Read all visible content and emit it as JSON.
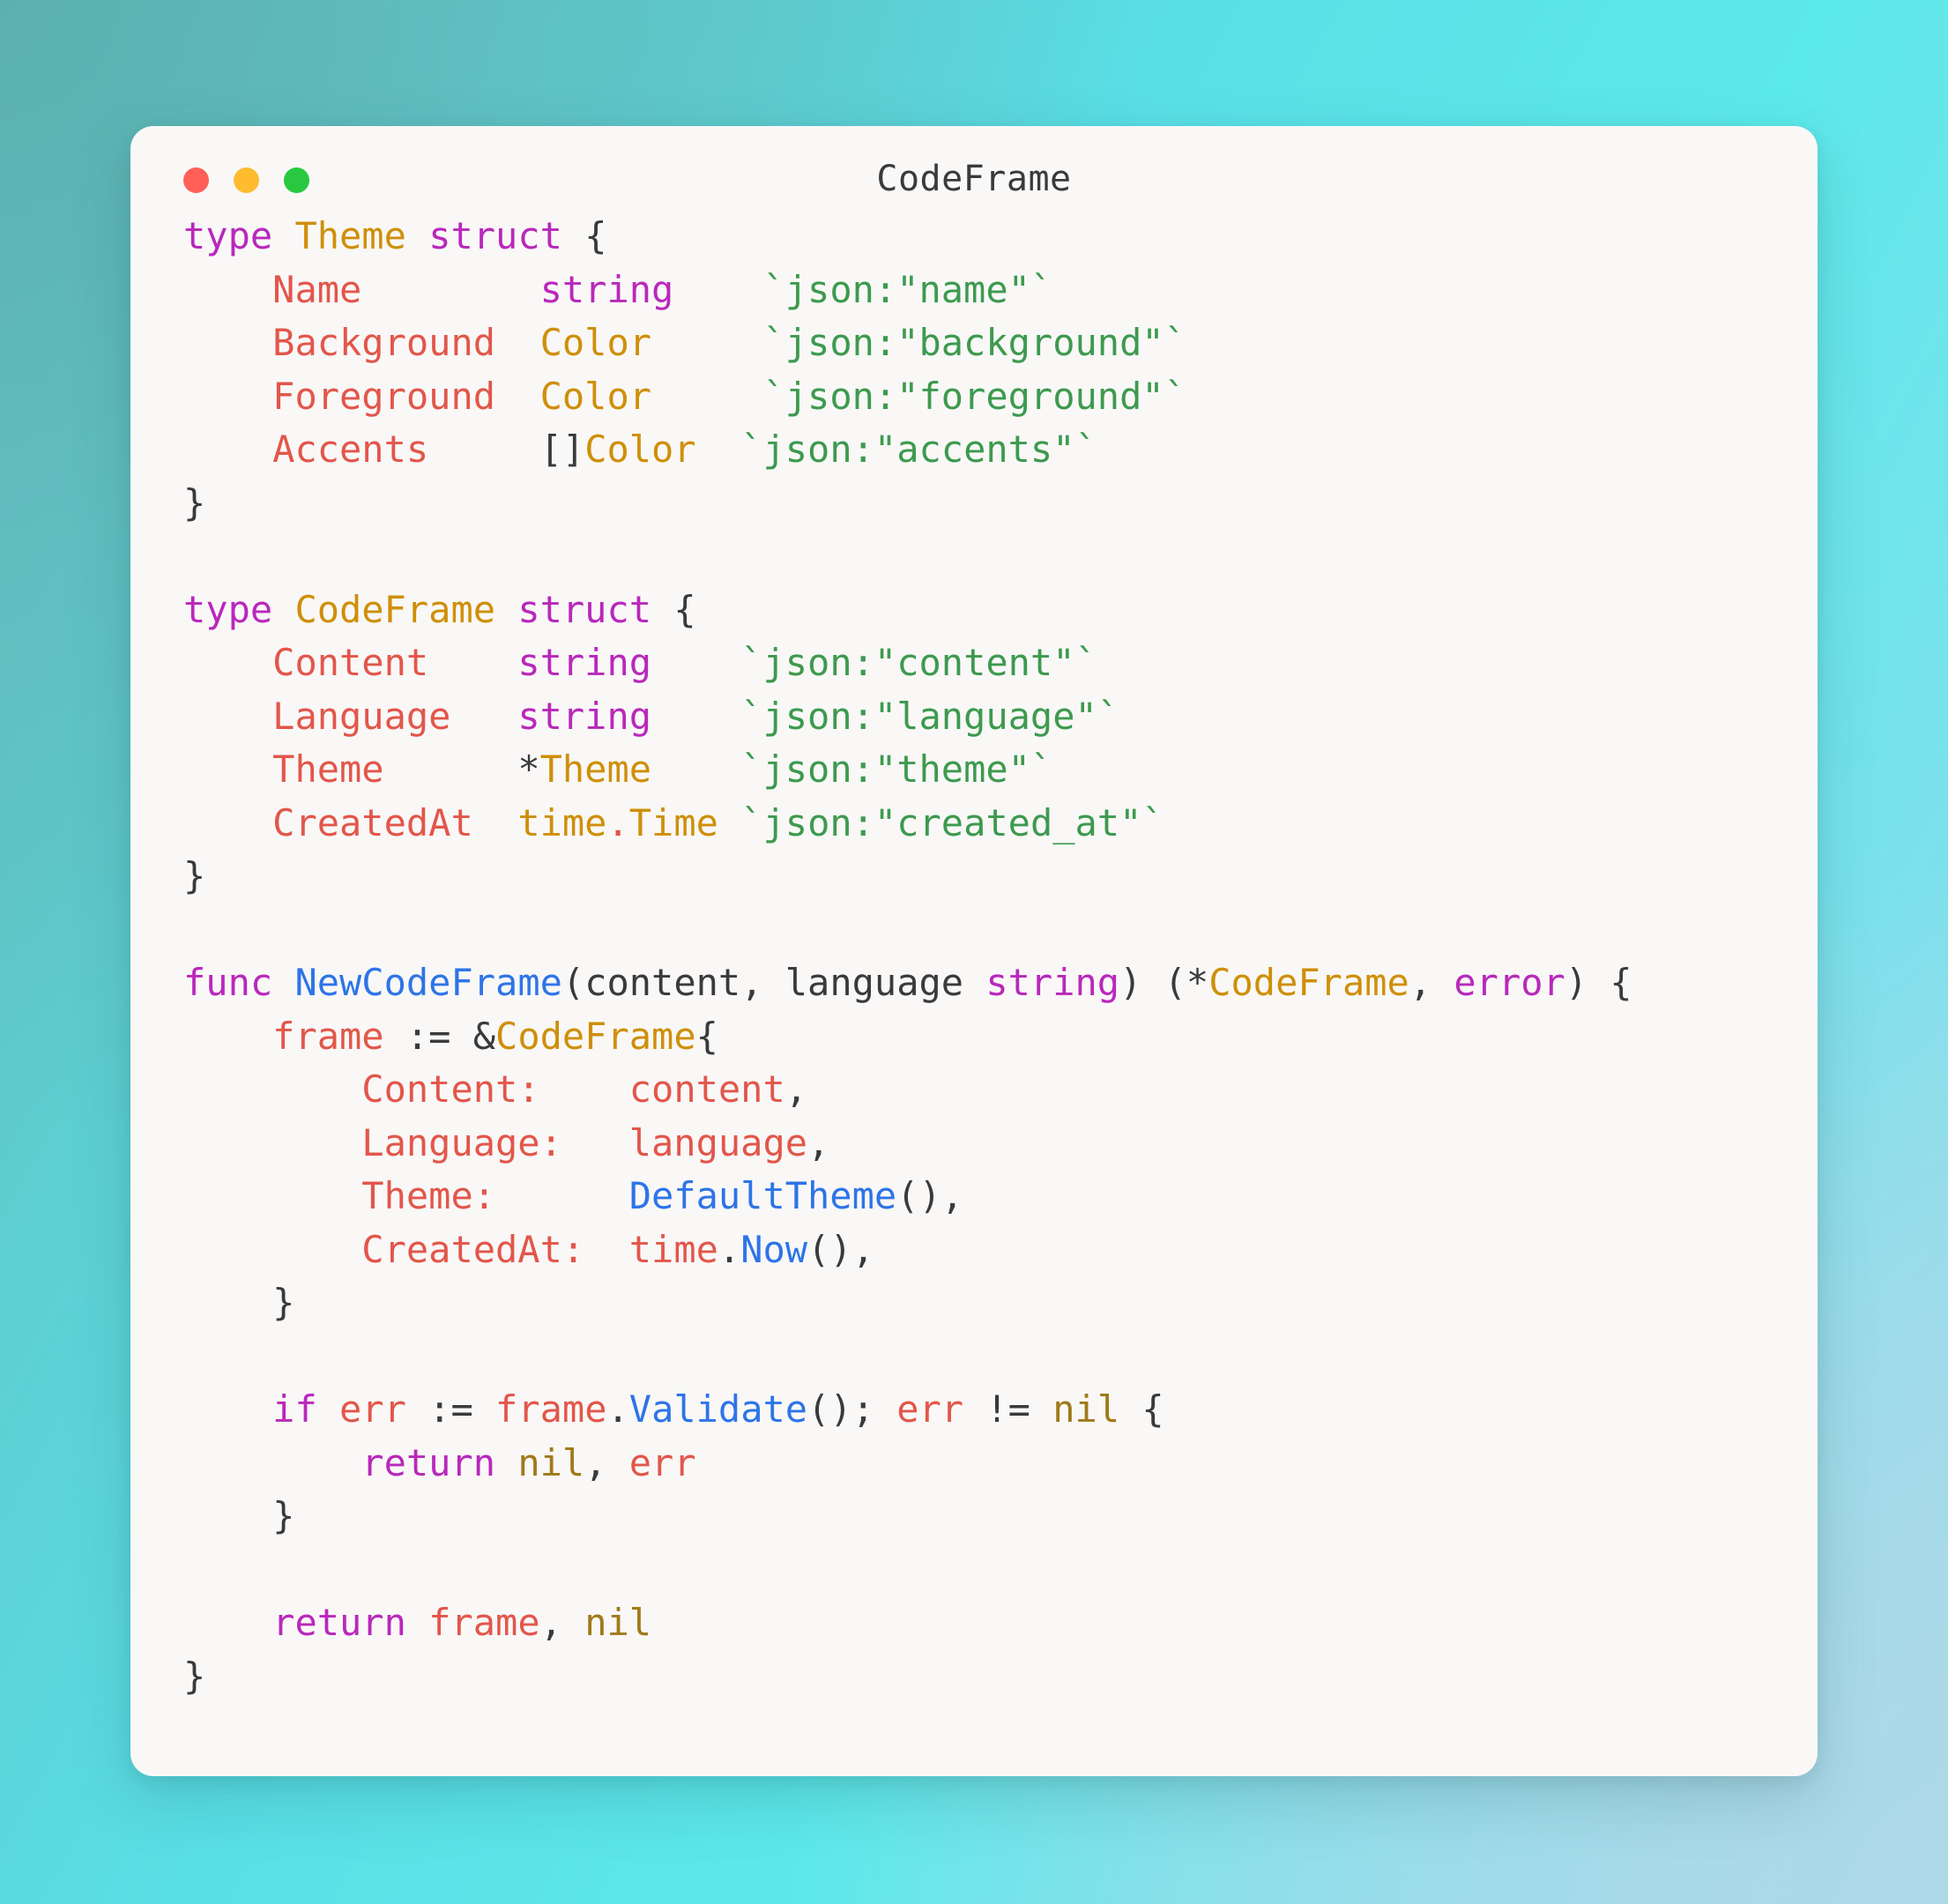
{
  "window": {
    "title": "CodeFrame",
    "traffic_lights": [
      {
        "name": "close",
        "color": "#ff5f57"
      },
      {
        "name": "minimize",
        "color": "#febc2e"
      },
      {
        "name": "maximize",
        "color": "#28c840"
      }
    ]
  },
  "theme_colors": {
    "card_background": "#f9f8f7",
    "keyword": "#b928bb",
    "type": "#cf8f09",
    "field": "#e3564a",
    "string": "#3d9a4e",
    "function": "#2e74e8",
    "nil_literal": "#a0791a",
    "punctuation": "#3a3a3c",
    "gradient_top_left": "#63b8b6",
    "gradient_top_right": "#5ce8e8",
    "gradient_bottom_left": "#5ce8e8",
    "gradient_bottom_right": "#aed9e8"
  },
  "code": {
    "language": "go",
    "lines": [
      {
        "tokens": [
          {
            "t": "type",
            "c": "kw"
          },
          {
            "t": " ",
            "c": "pun"
          },
          {
            "t": "Theme",
            "c": "type"
          },
          {
            "t": " ",
            "c": "pun"
          },
          {
            "t": "struct",
            "c": "kw"
          },
          {
            "t": " {",
            "c": "pun"
          }
        ]
      },
      {
        "tokens": [
          {
            "t": "    ",
            "c": "pun"
          },
          {
            "t": "Name",
            "c": "fld"
          },
          {
            "t": "        ",
            "c": "pun"
          },
          {
            "t": "string",
            "c": "kw"
          },
          {
            "t": "    ",
            "c": "pun"
          },
          {
            "t": "`json:\"name\"`",
            "c": "str"
          }
        ]
      },
      {
        "tokens": [
          {
            "t": "    ",
            "c": "pun"
          },
          {
            "t": "Background",
            "c": "fld"
          },
          {
            "t": "  ",
            "c": "pun"
          },
          {
            "t": "Color",
            "c": "type"
          },
          {
            "t": "     ",
            "c": "pun"
          },
          {
            "t": "`json:\"background\"`",
            "c": "str"
          }
        ]
      },
      {
        "tokens": [
          {
            "t": "    ",
            "c": "pun"
          },
          {
            "t": "Foreground",
            "c": "fld"
          },
          {
            "t": "  ",
            "c": "pun"
          },
          {
            "t": "Color",
            "c": "type"
          },
          {
            "t": "     ",
            "c": "pun"
          },
          {
            "t": "`json:\"foreground\"`",
            "c": "str"
          }
        ]
      },
      {
        "tokens": [
          {
            "t": "    ",
            "c": "pun"
          },
          {
            "t": "Accents",
            "c": "fld"
          },
          {
            "t": "     ",
            "c": "pun"
          },
          {
            "t": "[]",
            "c": "pun"
          },
          {
            "t": "Color",
            "c": "type"
          },
          {
            "t": "  ",
            "c": "pun"
          },
          {
            "t": "`json:\"accents\"`",
            "c": "str"
          }
        ]
      },
      {
        "tokens": [
          {
            "t": "}",
            "c": "pun"
          }
        ]
      },
      {
        "tokens": []
      },
      {
        "tokens": [
          {
            "t": "type",
            "c": "kw"
          },
          {
            "t": " ",
            "c": "pun"
          },
          {
            "t": "CodeFrame",
            "c": "type"
          },
          {
            "t": " ",
            "c": "pun"
          },
          {
            "t": "struct",
            "c": "kw"
          },
          {
            "t": " {",
            "c": "pun"
          }
        ]
      },
      {
        "tokens": [
          {
            "t": "    ",
            "c": "pun"
          },
          {
            "t": "Content",
            "c": "fld"
          },
          {
            "t": "    ",
            "c": "pun"
          },
          {
            "t": "string",
            "c": "kw"
          },
          {
            "t": "    ",
            "c": "pun"
          },
          {
            "t": "`json:\"content\"`",
            "c": "str"
          }
        ]
      },
      {
        "tokens": [
          {
            "t": "    ",
            "c": "pun"
          },
          {
            "t": "Language",
            "c": "fld"
          },
          {
            "t": "   ",
            "c": "pun"
          },
          {
            "t": "string",
            "c": "kw"
          },
          {
            "t": "    ",
            "c": "pun"
          },
          {
            "t": "`json:\"language\"`",
            "c": "str"
          }
        ]
      },
      {
        "tokens": [
          {
            "t": "    ",
            "c": "pun"
          },
          {
            "t": "Theme",
            "c": "fld"
          },
          {
            "t": "      ",
            "c": "pun"
          },
          {
            "t": "*",
            "c": "pun"
          },
          {
            "t": "Theme",
            "c": "type"
          },
          {
            "t": "    ",
            "c": "pun"
          },
          {
            "t": "`json:\"theme\"`",
            "c": "str"
          }
        ]
      },
      {
        "tokens": [
          {
            "t": "    ",
            "c": "pun"
          },
          {
            "t": "CreatedAt",
            "c": "fld"
          },
          {
            "t": "  ",
            "c": "pun"
          },
          {
            "t": "time",
            "c": "type"
          },
          {
            "t": ".",
            "c": "fld"
          },
          {
            "t": "Time",
            "c": "type"
          },
          {
            "t": " ",
            "c": "pun"
          },
          {
            "t": "`json:\"created_at\"`",
            "c": "str"
          }
        ]
      },
      {
        "tokens": [
          {
            "t": "}",
            "c": "pun"
          }
        ]
      },
      {
        "tokens": []
      },
      {
        "tokens": [
          {
            "t": "func",
            "c": "kw"
          },
          {
            "t": " ",
            "c": "pun"
          },
          {
            "t": "NewCodeFrame",
            "c": "fn"
          },
          {
            "t": "(",
            "c": "pun"
          },
          {
            "t": "content, language",
            "c": "par"
          },
          {
            "t": " ",
            "c": "pun"
          },
          {
            "t": "string",
            "c": "kw"
          },
          {
            "t": ") (*",
            "c": "pun"
          },
          {
            "t": "CodeFrame",
            "c": "type"
          },
          {
            "t": ", ",
            "c": "pun"
          },
          {
            "t": "error",
            "c": "kw"
          },
          {
            "t": ") {",
            "c": "pun"
          }
        ]
      },
      {
        "tokens": [
          {
            "t": "    ",
            "c": "pun"
          },
          {
            "t": "frame",
            "c": "fld"
          },
          {
            "t": " := &",
            "c": "pun"
          },
          {
            "t": "CodeFrame",
            "c": "type"
          },
          {
            "t": "{",
            "c": "pun"
          }
        ]
      },
      {
        "tokens": [
          {
            "t": "        ",
            "c": "pun"
          },
          {
            "t": "Content:",
            "c": "fld"
          },
          {
            "t": "    ",
            "c": "pun"
          },
          {
            "t": "content",
            "c": "fld"
          },
          {
            "t": ",",
            "c": "pun"
          }
        ]
      },
      {
        "tokens": [
          {
            "t": "        ",
            "c": "pun"
          },
          {
            "t": "Language:",
            "c": "fld"
          },
          {
            "t": "   ",
            "c": "pun"
          },
          {
            "t": "language",
            "c": "fld"
          },
          {
            "t": ",",
            "c": "pun"
          }
        ]
      },
      {
        "tokens": [
          {
            "t": "        ",
            "c": "pun"
          },
          {
            "t": "Theme:",
            "c": "fld"
          },
          {
            "t": "      ",
            "c": "pun"
          },
          {
            "t": "DefaultTheme",
            "c": "fn"
          },
          {
            "t": "(),",
            "c": "pun"
          }
        ]
      },
      {
        "tokens": [
          {
            "t": "        ",
            "c": "pun"
          },
          {
            "t": "CreatedAt:",
            "c": "fld"
          },
          {
            "t": "  ",
            "c": "pun"
          },
          {
            "t": "time",
            "c": "fld"
          },
          {
            "t": ".",
            "c": "pun"
          },
          {
            "t": "Now",
            "c": "fn"
          },
          {
            "t": "(),",
            "c": "pun"
          }
        ]
      },
      {
        "tokens": [
          {
            "t": "    }",
            "c": "pun"
          }
        ]
      },
      {
        "tokens": []
      },
      {
        "tokens": [
          {
            "t": "    ",
            "c": "pun"
          },
          {
            "t": "if",
            "c": "kw"
          },
          {
            "t": " ",
            "c": "pun"
          },
          {
            "t": "err",
            "c": "fld"
          },
          {
            "t": " := ",
            "c": "pun"
          },
          {
            "t": "frame",
            "c": "fld"
          },
          {
            "t": ".",
            "c": "pun"
          },
          {
            "t": "Validate",
            "c": "fn"
          },
          {
            "t": "(); ",
            "c": "pun"
          },
          {
            "t": "err",
            "c": "fld"
          },
          {
            "t": " != ",
            "c": "pun"
          },
          {
            "t": "nil",
            "c": "nil"
          },
          {
            "t": " {",
            "c": "pun"
          }
        ]
      },
      {
        "tokens": [
          {
            "t": "        ",
            "c": "pun"
          },
          {
            "t": "return",
            "c": "kw"
          },
          {
            "t": " ",
            "c": "pun"
          },
          {
            "t": "nil",
            "c": "nil"
          },
          {
            "t": ", ",
            "c": "pun"
          },
          {
            "t": "err",
            "c": "fld"
          }
        ]
      },
      {
        "tokens": [
          {
            "t": "    }",
            "c": "pun"
          }
        ]
      },
      {
        "tokens": []
      },
      {
        "tokens": [
          {
            "t": "    ",
            "c": "pun"
          },
          {
            "t": "return",
            "c": "kw"
          },
          {
            "t": " ",
            "c": "pun"
          },
          {
            "t": "frame",
            "c": "fld"
          },
          {
            "t": ", ",
            "c": "pun"
          },
          {
            "t": "nil",
            "c": "nil"
          }
        ]
      },
      {
        "tokens": [
          {
            "t": "}",
            "c": "pun"
          }
        ]
      }
    ]
  }
}
